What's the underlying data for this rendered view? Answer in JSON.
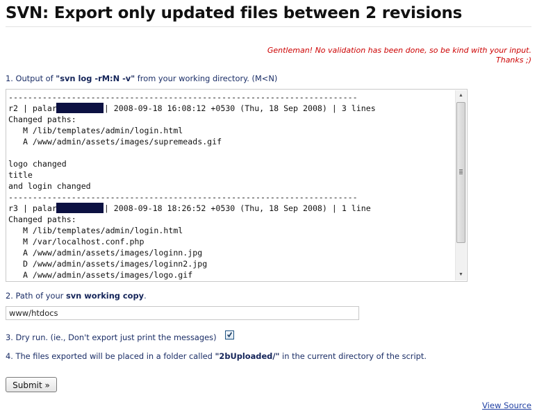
{
  "page": {
    "title": "SVN: Export only updated files between 2 revisions"
  },
  "warning": {
    "line1": "Gentleman! No validation has been done, so be kind with your input.",
    "line2": "Thanks ;)"
  },
  "step1": {
    "prefix": "1. Output of ",
    "command": "\"svn log -rM:N -v\"",
    "suffix": " from your working directory. (M<N)"
  },
  "log": {
    "lines": [
      {
        "text": "------------------------------------------------------------------------"
      },
      {
        "before": "r2 | palar",
        "after": "| 2008-09-18 16:08:12 +0530 (Thu, 18 Sep 2008) | 3 lines"
      },
      {
        "text": "Changed paths:"
      },
      {
        "text": "   M /lib/templates/admin/login.html"
      },
      {
        "text": "   A /www/admin/assets/images/supremeads.gif"
      },
      {
        "text": ""
      },
      {
        "text": "logo changed"
      },
      {
        "text": "title"
      },
      {
        "text": "and login changed"
      },
      {
        "text": "------------------------------------------------------------------------"
      },
      {
        "before": "r3 | palar",
        "after": "| 2008-09-18 18:26:52 +0530 (Thu, 18 Sep 2008) | 1 line"
      },
      {
        "text": "Changed paths:"
      },
      {
        "text": "   M /lib/templates/admin/login.html"
      },
      {
        "text": "   M /var/localhost.conf.php"
      },
      {
        "text": "   A /www/admin/assets/images/loginn.jpg"
      },
      {
        "text": "   D /www/admin/assets/images/loginn2.jpg"
      },
      {
        "text": "   A /www/admin/assets/images/logo.gif"
      }
    ],
    "scroll_position": 0.0
  },
  "step2": {
    "prefix": "2. Path of your ",
    "emphasis": "svn working copy",
    "suffix": "."
  },
  "path_input": {
    "value": "www/htdocs"
  },
  "step3": {
    "label": "3. Dry run. (ie., Don't export just print the messages)",
    "checked": true
  },
  "step4": {
    "prefix": "4. The files exported will be placed in a folder called ",
    "folder": "\"2bUploaded/\"",
    "suffix": " in the current directory of the script."
  },
  "submit": {
    "label": "Submit »"
  },
  "footer": {
    "view_source": "View Source"
  },
  "icons": {
    "scroll_up": "triangle-up-icon",
    "scroll_down": "triangle-down-icon",
    "checkbox": "checkmark-icon"
  }
}
